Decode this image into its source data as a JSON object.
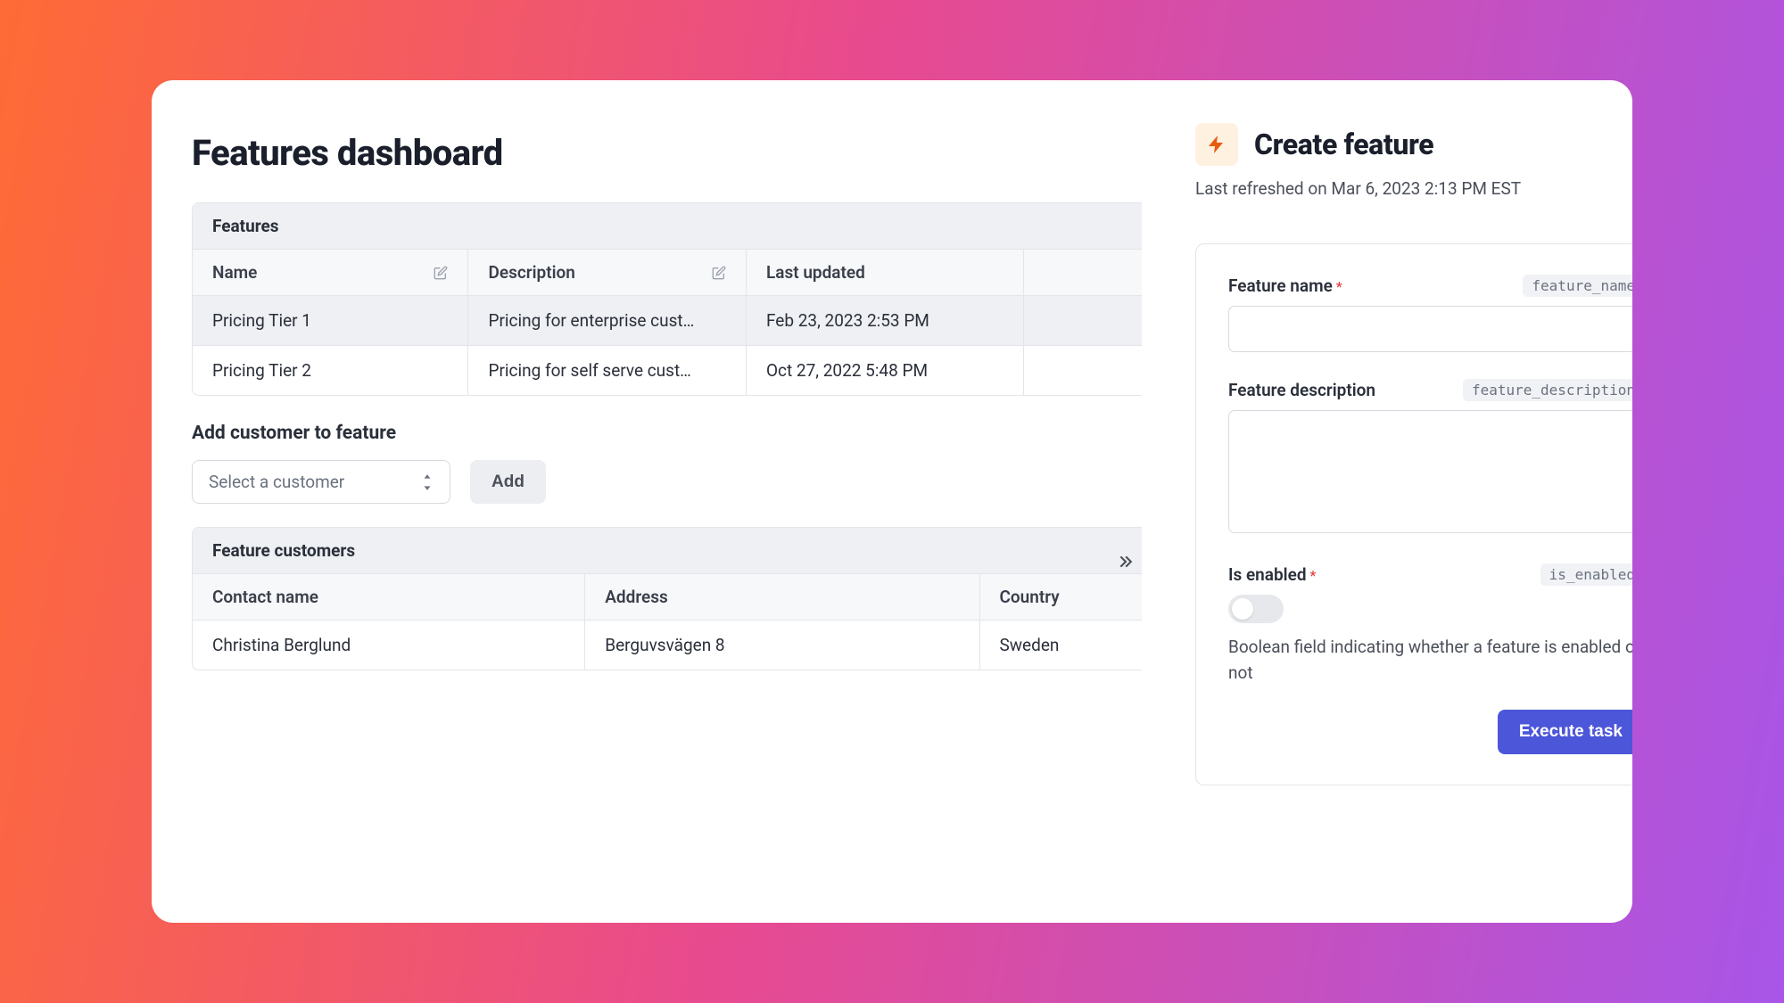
{
  "page": {
    "title": "Features dashboard"
  },
  "featuresTable": {
    "title": "Features",
    "columns": {
      "name": "Name",
      "description": "Description",
      "lastUpdated": "Last updated"
    },
    "rows": [
      {
        "name": "Pricing Tier 1",
        "description": "Pricing for enterprise cust…",
        "lastUpdated": "Feb 23, 2023 2:53 PM"
      },
      {
        "name": "Pricing Tier 2",
        "description": "Pricing for self serve cust…",
        "lastUpdated": "Oct 27, 2022 5:48 PM"
      }
    ]
  },
  "addCustomer": {
    "sectionLabel": "Add customer to feature",
    "selectPlaceholder": "Select a customer",
    "addLabel": "Add"
  },
  "customersTable": {
    "title": "Feature customers",
    "columns": {
      "contact": "Contact name",
      "address": "Address",
      "country": "Country"
    },
    "rows": [
      {
        "contact": "Christina Berglund",
        "address": "Berguvsvägen 8",
        "country": "Sweden"
      }
    ]
  },
  "sidePanel": {
    "title": "Create feature",
    "refreshText": "Last refreshed on Mar 6, 2023 2:13 PM EST",
    "featureName": {
      "label": "Feature name",
      "code": "feature_name",
      "value": ""
    },
    "featureDescription": {
      "label": "Feature description",
      "code": "feature_description",
      "value": ""
    },
    "isEnabled": {
      "label": "Is enabled",
      "code": "is_enabled",
      "help": "Boolean field indicating whether a feature is enabled or not",
      "value": false
    },
    "executeLabel": "Execute task"
  }
}
